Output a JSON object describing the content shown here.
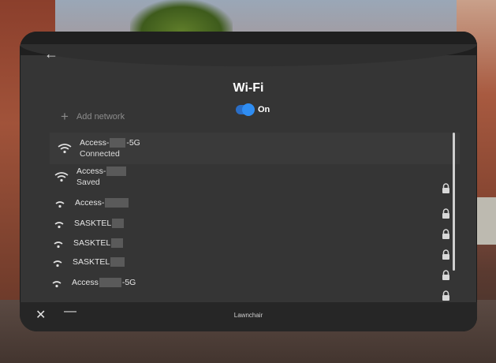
{
  "page": {
    "title": "Wi-Fi",
    "back_icon": "arrow-left-icon",
    "wifi_toggle": {
      "label": "On",
      "enabled": true,
      "accent": "#2f8df2"
    },
    "add_network_label": "Add network"
  },
  "networks": [
    {
      "name_prefix": "Access-",
      "name_suffix": "-5G",
      "status": "Connected",
      "locked": false
    },
    {
      "name_prefix": "Access-",
      "name_suffix": "",
      "status": "Saved",
      "locked": true
    },
    {
      "name_prefix": "Access-",
      "name_suffix": "",
      "status": "",
      "locked": true
    },
    {
      "name_prefix": "SASKTEL",
      "name_suffix": "",
      "status": "",
      "locked": true
    },
    {
      "name_prefix": "SASKTEL",
      "name_suffix": "",
      "status": "",
      "locked": true
    },
    {
      "name_prefix": "SASKTEL",
      "name_suffix": "",
      "status": "",
      "locked": true
    },
    {
      "name_prefix": "Access",
      "name_suffix": "-5G",
      "status": "",
      "locked": true
    }
  ],
  "bottom_bar": {
    "app_name": "Lawnchair",
    "close_icon": "close-icon",
    "minimize_icon": "minimize-icon"
  }
}
